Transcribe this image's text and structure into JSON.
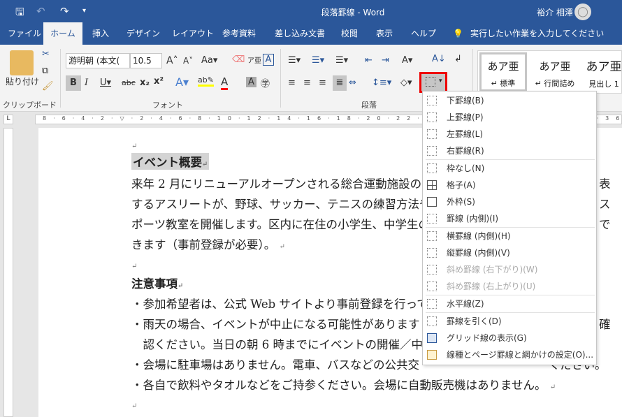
{
  "titlebar": {
    "title": "段落罫線 - Word",
    "user": "裕介 相澤",
    "save_icon": "save-icon",
    "undo_icon": "undo-icon",
    "redo_icon": "redo-icon"
  },
  "tabs": [
    "ファイル",
    "ホーム",
    "挿入",
    "デザイン",
    "レイアウト",
    "参考資料",
    "差し込み文書",
    "校閲",
    "表示",
    "ヘルプ"
  ],
  "active_tab": "ホーム",
  "tell_me": "実行したい作業を入力してください",
  "ribbon": {
    "clipboard": {
      "label": "クリップボード",
      "paste": "貼り付け"
    },
    "font": {
      "label": "フォント",
      "font_name": "游明朝 (本文(",
      "font_size": "10.5",
      "highlight_color": "#ffff00",
      "font_color": "#ff0000"
    },
    "paragraph": {
      "label": "段落"
    },
    "styles": [
      {
        "preview": "あア亜",
        "name": "↵ 標準"
      },
      {
        "preview": "あア亜",
        "name": "↵ 行間詰め"
      },
      {
        "preview": "あア亜",
        "name": "見出し 1"
      }
    ]
  },
  "document": {
    "heading1": "イベント概要",
    "para": [
      "来年 2 月にリニューアルオープンされる総合運動施設の",
      "するアスリートが、野球、サッカー、テニスの練習方法や",
      "ポーツ教室を開催します。区内に在住の小学生、中学生の",
      "きます（事前登録が必要）。"
    ],
    "para_right": [
      "表",
      "ス",
      "で"
    ],
    "heading2": "注意事項",
    "bullets": [
      "・参加希望者は、公式 Web サイトより事前登録を行って",
      "・雨天の場合、イベントが中止になる可能性があります",
      "　認ください。当日の朝 6 時までにイベントの開催／中",
      "・会場に駐車場はありません。電車、バスなどの公共交",
      "・各自で飲料やタオルなどをご持参ください。会場に自動販売機はありません。"
    ],
    "bullet_right": [
      "",
      "確",
      "",
      "ください。",
      ""
    ],
    "para_mark": "↵"
  },
  "border_menu": {
    "items": [
      {
        "label": "下罫線(B)",
        "icon": "bottom-border-icon",
        "enabled": true
      },
      {
        "label": "上罫線(P)",
        "icon": "top-border-icon",
        "enabled": true
      },
      {
        "label": "左罫線(L)",
        "icon": "left-border-icon",
        "enabled": true
      },
      {
        "label": "右罫線(R)",
        "icon": "right-border-icon",
        "enabled": true
      },
      {
        "label": "枠なし(N)",
        "icon": "no-border-icon",
        "enabled": true
      },
      {
        "label": "格子(A)",
        "icon": "all-borders-icon",
        "enabled": true
      },
      {
        "label": "外枠(S)",
        "icon": "outside-borders-icon",
        "enabled": true
      },
      {
        "label": "罫線 (内側)(I)",
        "icon": "inside-borders-icon",
        "enabled": true
      },
      {
        "label": "横罫線 (内側)(H)",
        "icon": "inside-horizontal-border-icon",
        "enabled": true
      },
      {
        "label": "縦罫線 (内側)(V)",
        "icon": "inside-vertical-border-icon",
        "enabled": true
      },
      {
        "label": "斜め罫線 (右下がり)(W)",
        "icon": "diagonal-down-border-icon",
        "enabled": false
      },
      {
        "label": "斜め罫線 (右上がり)(U)",
        "icon": "diagonal-up-border-icon",
        "enabled": false
      },
      {
        "label": "水平線(Z)",
        "icon": "horizontal-line-icon",
        "enabled": true
      },
      {
        "label": "罫線を引く(D)",
        "icon": "draw-table-icon",
        "enabled": true
      },
      {
        "label": "グリッド線の表示(G)",
        "icon": "view-gridlines-icon",
        "enabled": true
      },
      {
        "label": "線種とページ罫線と網かけの設定(O)...",
        "icon": "borders-shading-icon",
        "enabled": true
      }
    ]
  },
  "highlight_color": "#ff0000"
}
